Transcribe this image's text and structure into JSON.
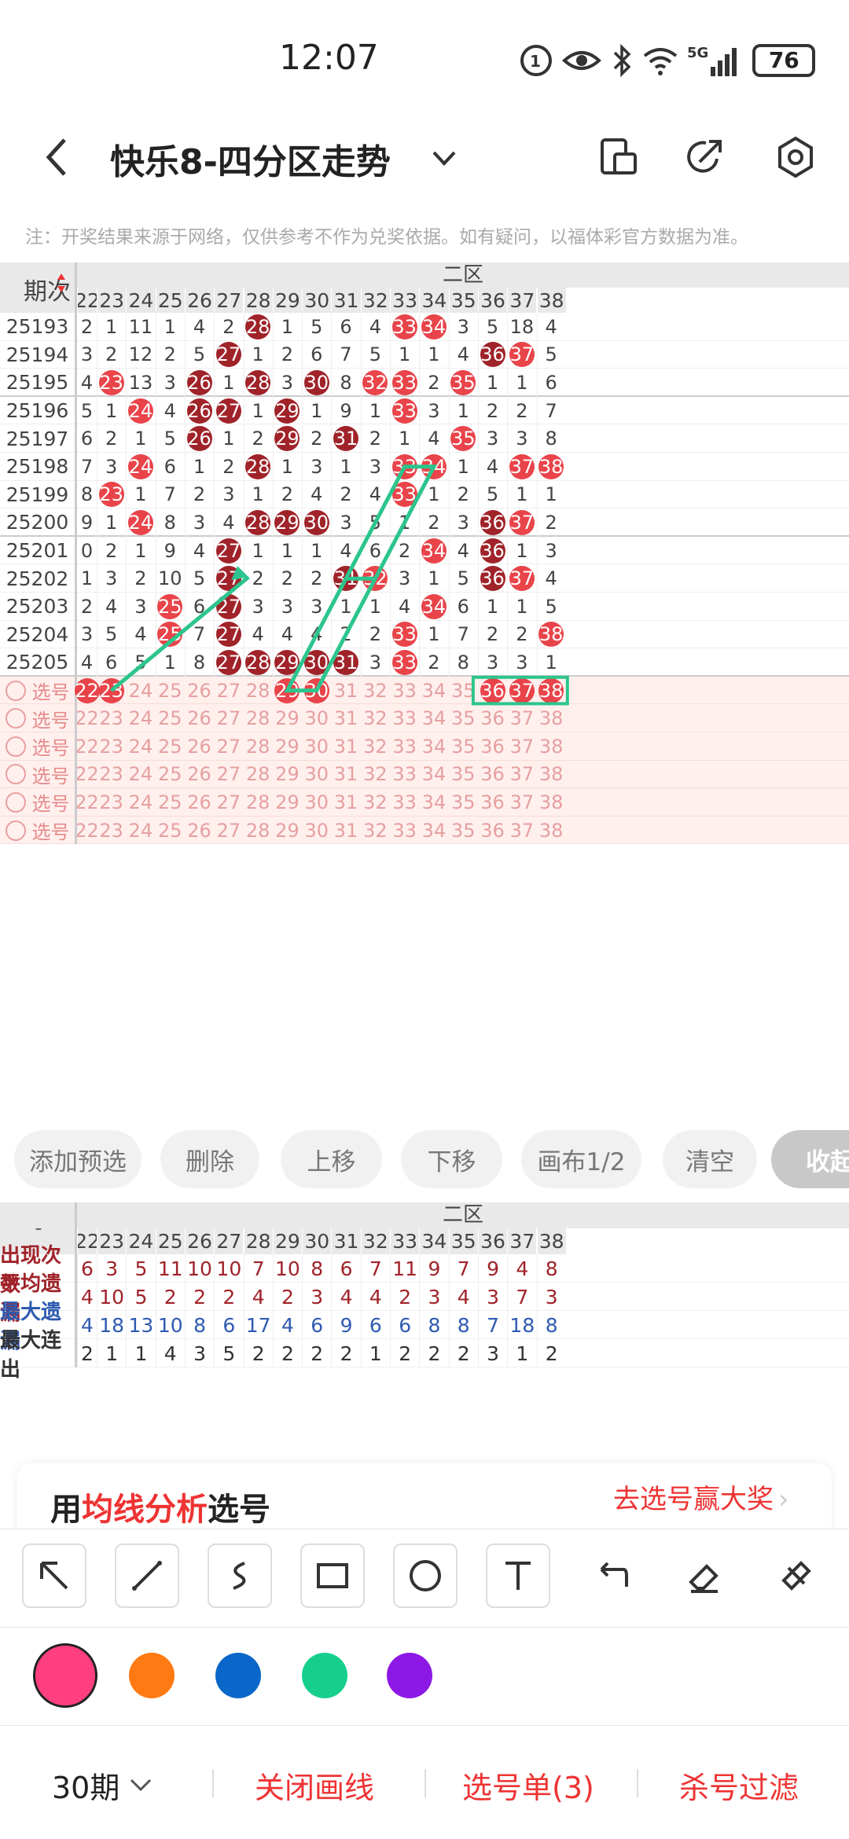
{
  "status": {
    "time": "12:07",
    "battery": "76",
    "network": "5G"
  },
  "header": {
    "title": "快乐8-四分区走势"
  },
  "note": "注：开奖结果来源于网络，仅供参考不作为兑奖依据。如有疑问，以福体彩官方数据为准。",
  "table": {
    "period_header": "期次",
    "zone": "二区",
    "columns": [
      "22",
      "23",
      "24",
      "25",
      "26",
      "27",
      "28",
      "29",
      "30",
      "31",
      "32",
      "33",
      "34",
      "35",
      "36",
      "37",
      "38"
    ],
    "rows": [
      {
        "period": "25193",
        "cells": [
          "2",
          "1",
          "11",
          "1",
          "4",
          "2",
          "28",
          "1",
          "5",
          "6",
          "4",
          "33",
          "34",
          "3",
          "5",
          "18",
          "4"
        ]
      },
      {
        "period": "25194",
        "cells": [
          "3",
          "2",
          "12",
          "2",
          "5",
          "27",
          "1",
          "2",
          "6",
          "7",
          "5",
          "1",
          "1",
          "4",
          "36",
          "37",
          "5"
        ]
      },
      {
        "period": "25195",
        "cells": [
          "4",
          "23",
          "13",
          "3",
          "26",
          "1",
          "28",
          "3",
          "30",
          "8",
          "32",
          "33",
          "2",
          "35",
          "1",
          "1",
          "6"
        ]
      },
      {
        "period": "25196",
        "cells": [
          "5",
          "1",
          "24",
          "4",
          "26",
          "27",
          "1",
          "29",
          "1",
          "9",
          "1",
          "33",
          "3",
          "1",
          "2",
          "2",
          "7"
        ]
      },
      {
        "period": "25197",
        "cells": [
          "6",
          "2",
          "1",
          "5",
          "26",
          "1",
          "2",
          "29",
          "2",
          "31",
          "2",
          "1",
          "4",
          "35",
          "3",
          "3",
          "8"
        ]
      },
      {
        "period": "25198",
        "cells": [
          "7",
          "3",
          "24",
          "6",
          "1",
          "2",
          "28",
          "1",
          "3",
          "1",
          "3",
          "33",
          "34",
          "1",
          "4",
          "37",
          "38"
        ]
      },
      {
        "period": "25199",
        "cells": [
          "8",
          "23",
          "1",
          "7",
          "2",
          "3",
          "1",
          "2",
          "4",
          "2",
          "4",
          "33",
          "1",
          "2",
          "5",
          "1",
          "1"
        ]
      },
      {
        "period": "25200",
        "cells": [
          "9",
          "1",
          "24",
          "8",
          "3",
          "4",
          "28",
          "29",
          "30",
          "3",
          "5",
          "1",
          "2",
          "3",
          "36",
          "37",
          "2"
        ]
      },
      {
        "period": "25201",
        "cells": [
          "0",
          "2",
          "1",
          "9",
          "4",
          "27",
          "1",
          "1",
          "1",
          "4",
          "6",
          "2",
          "34",
          "4",
          "36",
          "1",
          "3"
        ]
      },
      {
        "period": "25202",
        "cells": [
          "1",
          "3",
          "2",
          "10",
          "5",
          "27",
          "2",
          "2",
          "2",
          "31",
          "32",
          "3",
          "1",
          "5",
          "36",
          "37",
          "4"
        ]
      },
      {
        "period": "25203",
        "cells": [
          "2",
          "4",
          "3",
          "25",
          "6",
          "27",
          "3",
          "3",
          "3",
          "1",
          "1",
          "4",
          "34",
          "6",
          "1",
          "1",
          "5"
        ]
      },
      {
        "period": "25204",
        "cells": [
          "3",
          "5",
          "4",
          "25",
          "7",
          "27",
          "4",
          "4",
          "4",
          "2",
          "2",
          "33",
          "1",
          "7",
          "2",
          "2",
          "38"
        ]
      },
      {
        "period": "25205",
        "cells": [
          "4",
          "6",
          "5",
          "1",
          "8",
          "27",
          "28",
          "29",
          "30",
          "31",
          "3",
          "33",
          "2",
          "8",
          "3",
          "3",
          "1"
        ]
      }
    ],
    "pick_label": "选号",
    "pick_rows": 6
  },
  "buttons": [
    "添加预选",
    "删除",
    "上移",
    "下移",
    "画布1/2",
    "清空",
    "收起"
  ],
  "stats": {
    "corner": "-",
    "zone": "二区",
    "rows": [
      {
        "label": "出现次数",
        "values": [
          "6",
          "3",
          "5",
          "11",
          "10",
          "10",
          "7",
          "10",
          "8",
          "6",
          "7",
          "11",
          "9",
          "7",
          "9",
          "4",
          "8"
        ]
      },
      {
        "label": "平均遗漏",
        "values": [
          "4",
          "10",
          "5",
          "2",
          "2",
          "2",
          "4",
          "2",
          "3",
          "4",
          "4",
          "2",
          "3",
          "4",
          "3",
          "7",
          "3"
        ]
      },
      {
        "label": "最大遗漏",
        "values": [
          "4",
          "18",
          "13",
          "10",
          "8",
          "6",
          "17",
          "4",
          "6",
          "9",
          "6",
          "6",
          "8",
          "8",
          "7",
          "18",
          "8"
        ]
      },
      {
        "label": "最大连出",
        "values": [
          "2",
          "1",
          "1",
          "4",
          "3",
          "5",
          "2",
          "2",
          "2",
          "2",
          "1",
          "2",
          "2",
          "2",
          "3",
          "1",
          "2"
        ]
      }
    ]
  },
  "promo": {
    "prefix": "用",
    "highlight": "均线分析",
    "suffix": "选号",
    "link": "去选号赢大奖"
  },
  "tools": [
    "arrow-tool-icon",
    "line-tool-icon",
    "curve-tool-icon",
    "rectangle-tool-icon",
    "circle-tool-icon",
    "text-tool-icon",
    "undo-icon",
    "eraser-icon",
    "clear-brush-icon"
  ],
  "colors": [
    "#ff3f7f",
    "#ff7a12",
    "#0a66c8",
    "#16cf8c",
    "#8d18e6"
  ],
  "bottom": {
    "periods": "30期",
    "close_lines": "关闭画线",
    "pick_list": "选号单(3)",
    "filter": "杀号过滤"
  }
}
